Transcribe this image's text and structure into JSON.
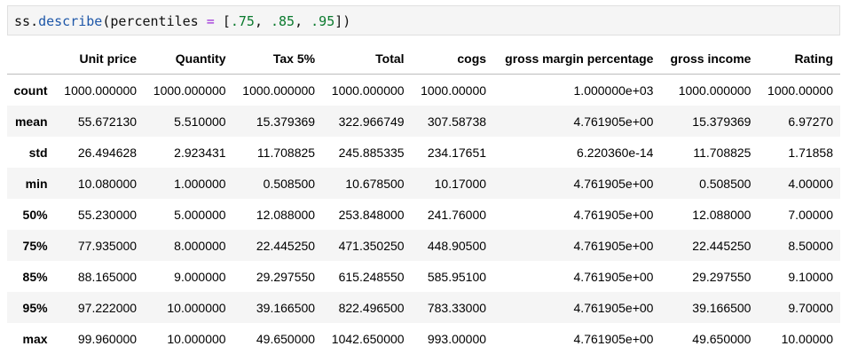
{
  "cell": {
    "obj": "ss",
    "dot": ".",
    "method": "describe",
    "lparen": "(",
    "param": "percentiles",
    "eq": " = ",
    "lbracket": "[",
    "v1": ".75",
    "sep1": ", ",
    "v2": ".85",
    "sep2": ", ",
    "v3": ".95",
    "rbracket": "]",
    "rparen": ")"
  },
  "table": {
    "columns": [
      "",
      "Unit price",
      "Quantity",
      "Tax 5%",
      "Total",
      "cogs",
      "gross margin percentage",
      "gross income",
      "Rating"
    ],
    "rows": [
      {
        "index": "count",
        "values": [
          "1000.000000",
          "1000.000000",
          "1000.000000",
          "1000.000000",
          "1000.00000",
          "1.000000e+03",
          "1000.000000",
          "1000.00000"
        ]
      },
      {
        "index": "mean",
        "values": [
          "55.672130",
          "5.510000",
          "15.379369",
          "322.966749",
          "307.58738",
          "4.761905e+00",
          "15.379369",
          "6.97270"
        ]
      },
      {
        "index": "std",
        "values": [
          "26.494628",
          "2.923431",
          "11.708825",
          "245.885335",
          "234.17651",
          "6.220360e-14",
          "11.708825",
          "1.71858"
        ]
      },
      {
        "index": "min",
        "values": [
          "10.080000",
          "1.000000",
          "0.508500",
          "10.678500",
          "10.17000",
          "4.761905e+00",
          "0.508500",
          "4.00000"
        ]
      },
      {
        "index": "50%",
        "values": [
          "55.230000",
          "5.000000",
          "12.088000",
          "253.848000",
          "241.76000",
          "4.761905e+00",
          "12.088000",
          "7.00000"
        ]
      },
      {
        "index": "75%",
        "values": [
          "77.935000",
          "8.000000",
          "22.445250",
          "471.350250",
          "448.90500",
          "4.761905e+00",
          "22.445250",
          "8.50000"
        ]
      },
      {
        "index": "85%",
        "values": [
          "88.165000",
          "9.000000",
          "29.297550",
          "615.248550",
          "585.95100",
          "4.761905e+00",
          "29.297550",
          "9.10000"
        ]
      },
      {
        "index": "95%",
        "values": [
          "97.222000",
          "10.000000",
          "39.166500",
          "822.496500",
          "783.33000",
          "4.761905e+00",
          "39.166500",
          "9.70000"
        ]
      },
      {
        "index": "max",
        "values": [
          "99.960000",
          "10.000000",
          "49.650000",
          "1042.650000",
          "993.00000",
          "4.761905e+00",
          "49.650000",
          "10.00000"
        ]
      }
    ]
  }
}
